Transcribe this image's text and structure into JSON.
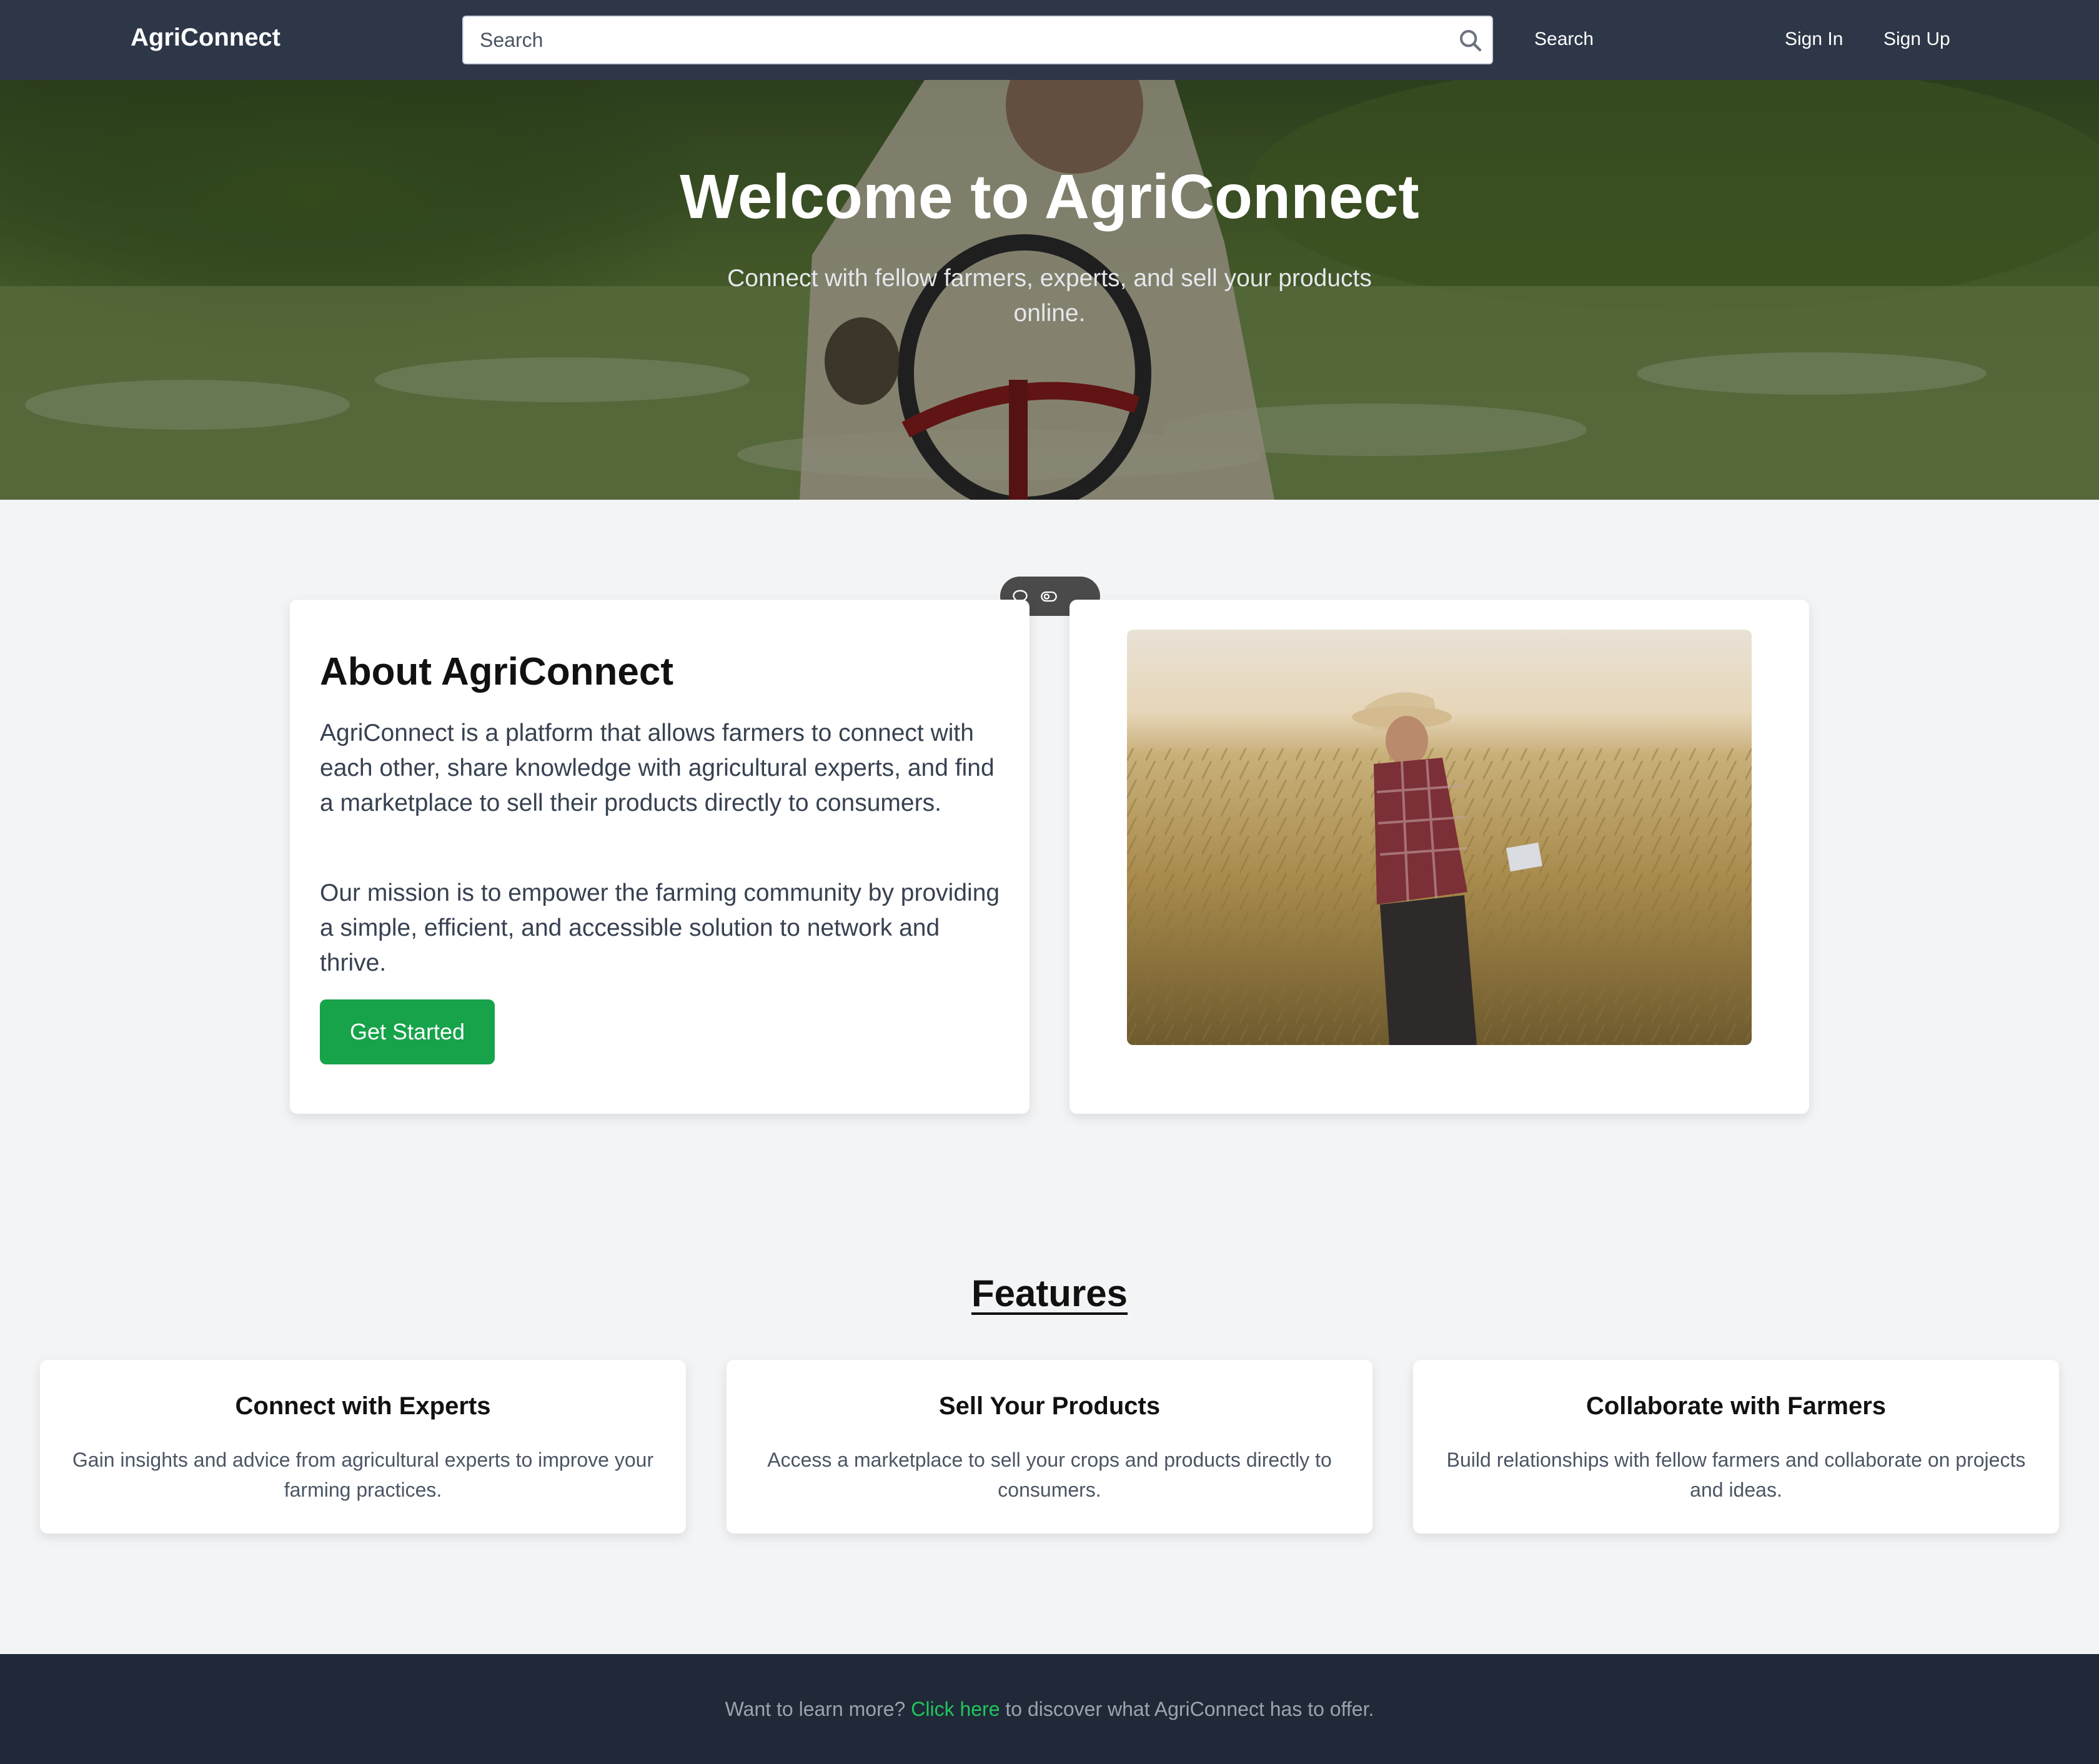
{
  "header": {
    "brand": "AgriConnect",
    "search_placeholder": "Search",
    "nav": {
      "search": "Search",
      "sign_in": "Sign In",
      "sign_up": "Sign Up"
    }
  },
  "hero": {
    "title": "Welcome to AgriConnect",
    "subtitle": "Connect with fellow farmers, experts, and sell your products online."
  },
  "floating_toolbar": {
    "icons": [
      "chat-bubble-icon",
      "toggle-icon"
    ]
  },
  "about": {
    "title": "About AgriConnect",
    "paragraph1": "AgriConnect is a platform that allows farmers to connect with each other, share knowledge with agricultural experts, and find a marketplace to sell their products directly to consumers.",
    "paragraph2": "Our mission is to empower the farming community by providing a simple, efficient, and accessible solution to network and thrive.",
    "cta": "Get Started"
  },
  "features": {
    "title": "Features",
    "items": [
      {
        "title": "Connect with Experts",
        "description": "Gain insights and advice from agricultural experts to improve your farming practices."
      },
      {
        "title": "Sell Your Products",
        "description": "Access a marketplace to sell your crops and products directly to consumers."
      },
      {
        "title": "Collaborate with Farmers",
        "description": "Build relationships with fellow farmers and collaborate on projects and ideas."
      }
    ]
  },
  "footer": {
    "text_before": "Want to learn more? ",
    "link": "Click here",
    "text_after": " to discover what AgriConnect has to offer."
  },
  "colors": {
    "header_bg": "#2d3748",
    "accent_green": "#16a34a",
    "footer_bg": "#1f2937",
    "page_bg": "#f3f4f6"
  }
}
